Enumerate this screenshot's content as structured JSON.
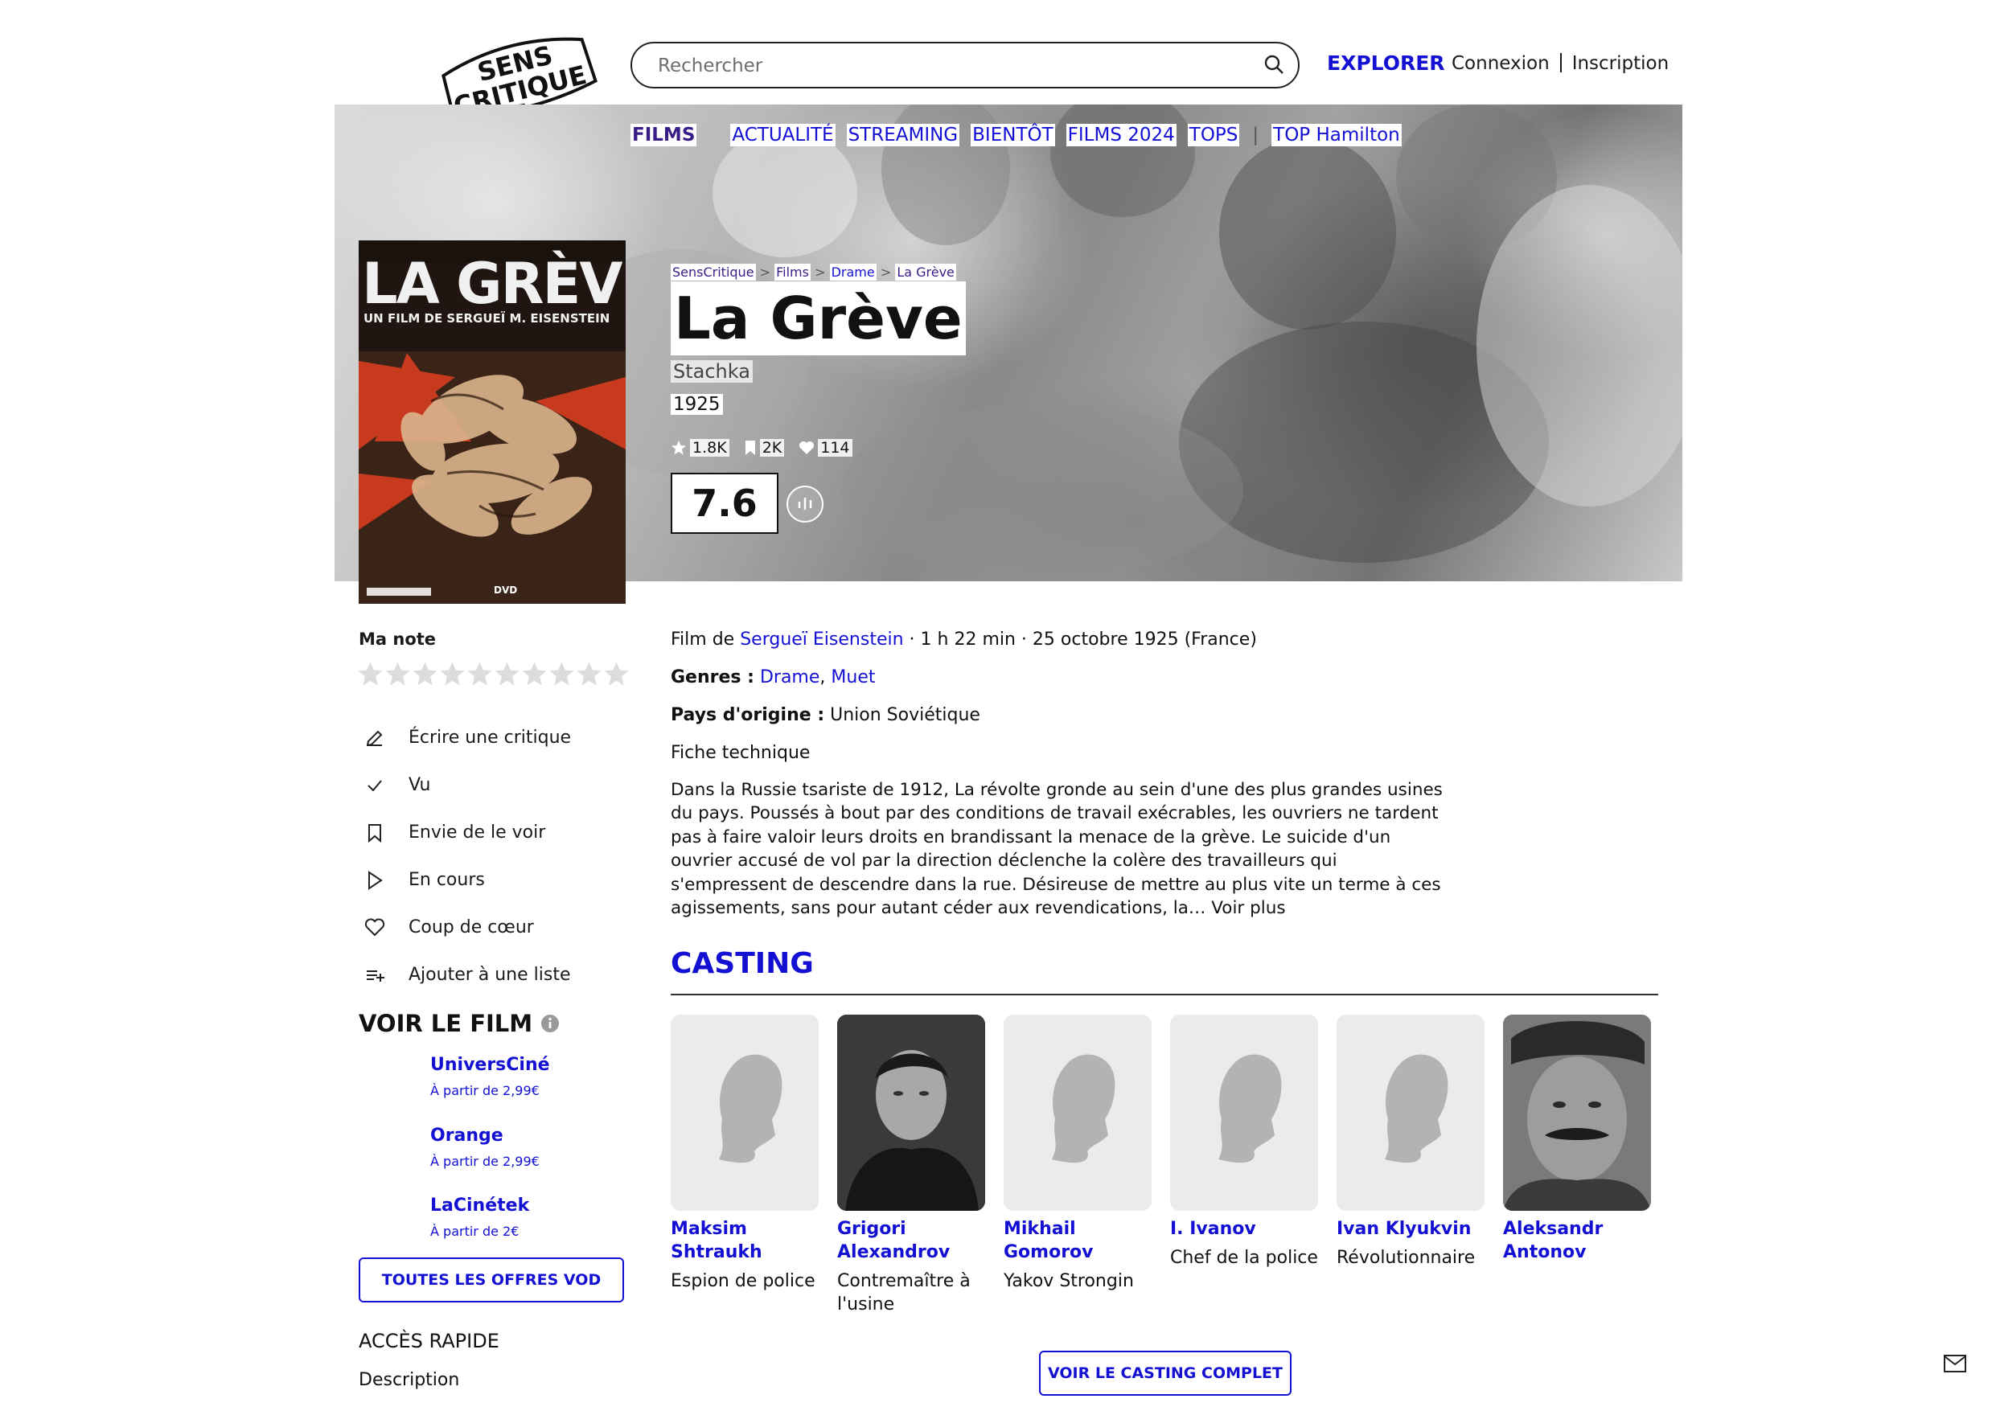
{
  "header": {
    "logo_text": "SENS CRITIQUE",
    "search_placeholder": "Rechercher",
    "explorer": "EXPLORER",
    "login": "Connexion",
    "signup": "Inscription"
  },
  "nav": {
    "films": "FILMS",
    "items": [
      "ACTUALITÉ",
      "STREAMING",
      "BIENTÔT",
      "FILMS 2024",
      "TOPS"
    ],
    "top_hamilton": "TOP Hamilton"
  },
  "breadcrumb": [
    "SensCritique",
    "Films",
    "Drame",
    "La Grève"
  ],
  "breadcrumb_sep": ">",
  "movie": {
    "poster_title": "LA GRÈVE",
    "poster_subtitle": "UN FILM DE SERGUEÏ M. EISENSTEIN",
    "poster_badge": "DVD",
    "title": "La Grève",
    "original_title": "Stachka",
    "year": "1925",
    "stats": {
      "ratings": "1.8K",
      "wishlist": "2K",
      "favorites": "114"
    },
    "score": "7.6"
  },
  "left": {
    "ma_note": "Ma note",
    "star_count": 10,
    "actions": [
      {
        "icon": "pencil-icon",
        "label": "Écrire une critique"
      },
      {
        "icon": "check-icon",
        "label": "Vu"
      },
      {
        "icon": "bookmark-icon",
        "label": "Envie de le voir"
      },
      {
        "icon": "play-icon",
        "label": "En cours"
      },
      {
        "icon": "heart-icon",
        "label": "Coup de cœur"
      },
      {
        "icon": "list-add-icon",
        "label": "Ajouter à une liste"
      }
    ],
    "voir_le_film": "VOIR LE FILM",
    "vod": [
      {
        "name": "UniversCiné",
        "price": "À partir de 2,99€"
      },
      {
        "name": "Orange",
        "price": "À partir de 2,99€"
      },
      {
        "name": "LaCinétek",
        "price": "À partir de 2€"
      }
    ],
    "all_offers": "TOUTES LES OFFRES VOD",
    "acces_rapide": "ACCÈS RAPIDE",
    "description_link": "Description"
  },
  "details": {
    "film_de": "Film de",
    "director": "Sergueï Eisenstein",
    "meta": "· 1 h 22 min · 25 octobre 1925 (France)",
    "genres_label": "Genres :",
    "genres": [
      "Drame",
      "Muet"
    ],
    "country_label": "Pays d'origine :",
    "country": "Union Soviétique",
    "fiche": "Fiche technique",
    "synopsis": "Dans la Russie tsariste de 1912, La révolte gronde au sein d'une des plus grandes usines du pays. Poussés à bout par des conditions de travail exécrables, les ouvriers ne tardent pas à faire valoir leurs droits en brandissant la menace de la grève. Le suicide d'un ouvrier accusé de vol par la direction déclenche la colère des travailleurs qui s'empressent de descendre dans la rue. Désireuse de mettre au plus vite un terme à ces agissements, sans pour autant céder aux revendications, la…",
    "voir_plus": "Voir plus"
  },
  "casting": {
    "heading": "CASTING",
    "actors": [
      {
        "first": "Maksim",
        "last": "Shtraukh",
        "role": "Espion de police",
        "photo": "placeholder"
      },
      {
        "first": "Grigori",
        "last": "Alexandrov",
        "role": "Contremaître à l'usine",
        "photo": "portrait"
      },
      {
        "first": "Mikhail",
        "last": "Gomorov",
        "role": "Yakov Strongin",
        "photo": "placeholder"
      },
      {
        "first": "I. Ivanov",
        "last": "",
        "role": "Chef de la police",
        "photo": "placeholder"
      },
      {
        "first": "Ivan Klyukvin",
        "last": "",
        "role": "Révolutionnaire",
        "photo": "placeholder"
      },
      {
        "first": "Aleksandr",
        "last": "Antonov",
        "role": "",
        "photo": "portrait"
      }
    ],
    "full_cast": "VOIR LE CASTING COMPLET"
  },
  "colors": {
    "accent": "#1310d4",
    "nav_active": "#3a1d86"
  }
}
